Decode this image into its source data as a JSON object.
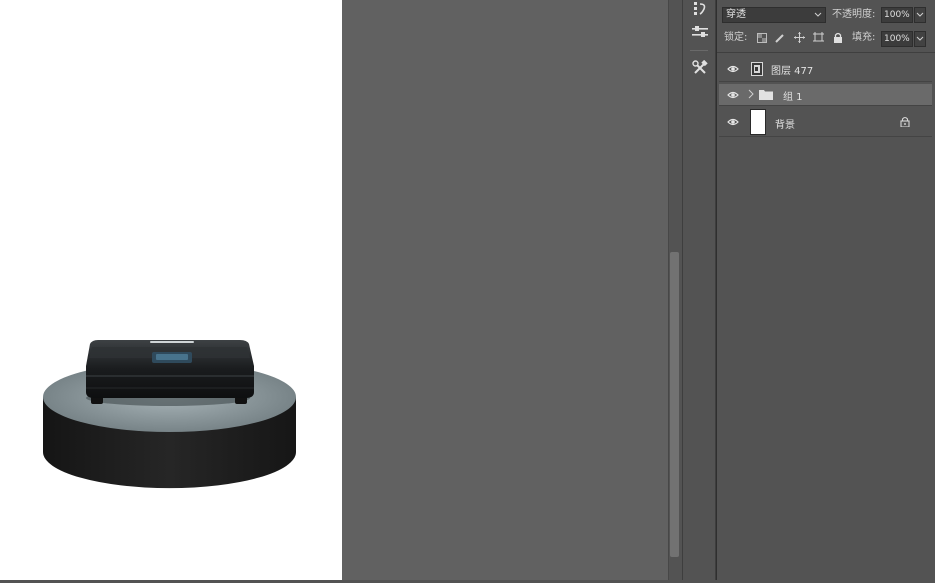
{
  "panel": {
    "blend_mode": "穿透",
    "opacity_label": "不透明度:",
    "opacity_value": "100%",
    "lock_label": "锁定:",
    "fill_label": "填充:",
    "fill_value": "100%"
  },
  "layers": [
    {
      "name": "图层 477",
      "type": "smart-object"
    },
    {
      "name": "组 1",
      "type": "group",
      "selected": true
    },
    {
      "name": "背景",
      "type": "background",
      "locked": true
    }
  ],
  "icons": {
    "tool1": "history-brush-icon",
    "tool2": "adjustments-icon",
    "tool3": "tools-icon",
    "eye": "eye-icon",
    "lock": "lock-icon"
  },
  "colors": {
    "panel_bg": "#535353",
    "canvas_gray": "#616161",
    "selected_row": "#6a6a6a",
    "field_bg": "#3c3c3c"
  }
}
